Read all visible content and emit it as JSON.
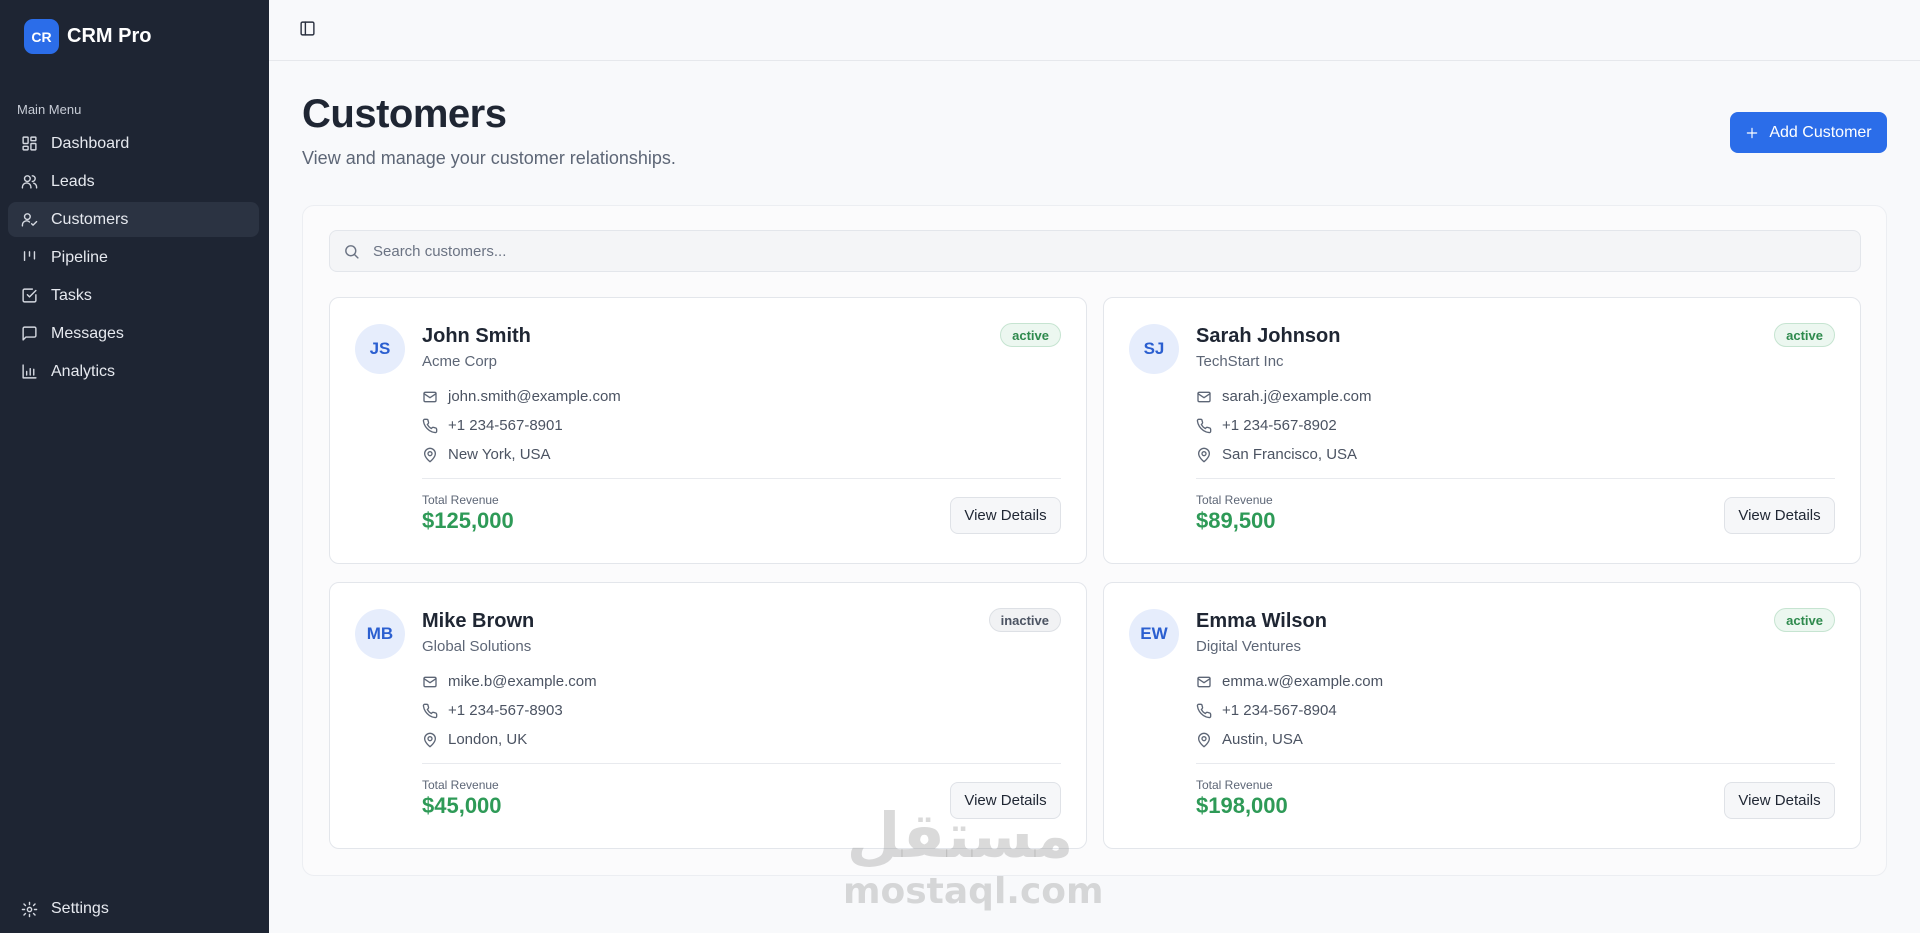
{
  "app": {
    "logo_text": "CR",
    "name": "CRM Pro"
  },
  "sidebar": {
    "heading": "Main Menu",
    "items": [
      {
        "label": "Dashboard",
        "icon": "layout-grid-icon",
        "active": false
      },
      {
        "label": "Leads",
        "icon": "users-icon",
        "active": false
      },
      {
        "label": "Customers",
        "icon": "user-check-icon",
        "active": true
      },
      {
        "label": "Pipeline",
        "icon": "kanban-icon",
        "active": false
      },
      {
        "label": "Tasks",
        "icon": "check-square-icon",
        "active": false
      },
      {
        "label": "Messages",
        "icon": "message-square-icon",
        "active": false
      },
      {
        "label": "Analytics",
        "icon": "bar-chart-icon",
        "active": false
      }
    ],
    "settings_label": "Settings"
  },
  "header": {
    "title": "Customers",
    "subtitle": "View and manage your customer relationships.",
    "add_button_label": "Add Customer"
  },
  "search": {
    "placeholder": "Search customers...",
    "value": ""
  },
  "customers": [
    {
      "initials": "JS",
      "name": "John Smith",
      "company": "Acme Corp",
      "status": "active",
      "email": "john.smith@example.com",
      "phone": "+1 234-567-8901",
      "location": "New York, USA",
      "revenue_label": "Total Revenue",
      "revenue": "$125,000",
      "action_label": "View Details"
    },
    {
      "initials": "SJ",
      "name": "Sarah Johnson",
      "company": "TechStart Inc",
      "status": "active",
      "email": "sarah.j@example.com",
      "phone": "+1 234-567-8902",
      "location": "San Francisco, USA",
      "revenue_label": "Total Revenue",
      "revenue": "$89,500",
      "action_label": "View Details"
    },
    {
      "initials": "MB",
      "name": "Mike Brown",
      "company": "Global Solutions",
      "status": "inactive",
      "email": "mike.b@example.com",
      "phone": "+1 234-567-8903",
      "location": "London, UK",
      "revenue_label": "Total Revenue",
      "revenue": "$45,000",
      "action_label": "View Details"
    },
    {
      "initials": "EW",
      "name": "Emma Wilson",
      "company": "Digital Ventures",
      "status": "active",
      "email": "emma.w@example.com",
      "phone": "+1 234-567-8904",
      "location": "Austin, USA",
      "revenue_label": "Total Revenue",
      "revenue": "$198,000",
      "action_label": "View Details"
    }
  ],
  "watermark": {
    "arabic": "مستقل",
    "latin": "mostaql.com"
  },
  "colors": {
    "sidebar_bg": "#1e2533",
    "accent": "#2b6de9",
    "revenue": "#2e9a57",
    "active_badge": "#2e8a4d"
  }
}
